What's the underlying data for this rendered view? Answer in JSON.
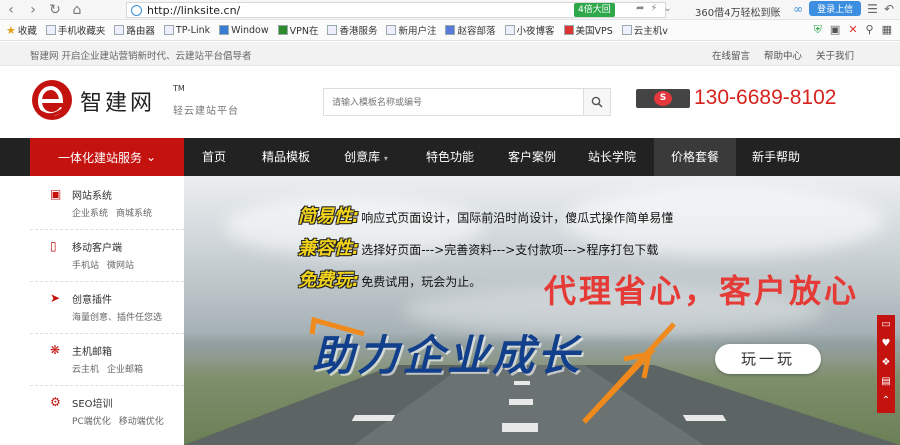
{
  "browser": {
    "url": "http://linksite.cn/",
    "badge": "4倍大回",
    "promo": "360借4万轻松到账",
    "login_button": "登录上信",
    "bookmarks": [
      {
        "label": "收藏",
        "icon": "star-icon"
      },
      {
        "label": "手机收藏夹",
        "icon": "phone-icon"
      },
      {
        "label": "路由器",
        "icon": "router-icon"
      },
      {
        "label": "TP-Link",
        "icon": "page-icon"
      },
      {
        "label": "Window",
        "icon": "windows-icon"
      },
      {
        "label": "VPN在",
        "icon": "vpn-icon"
      },
      {
        "label": "香港服务",
        "icon": "page-icon"
      },
      {
        "label": "新用户注",
        "icon": "page-icon"
      },
      {
        "label": "赵容部落",
        "icon": "user-icon"
      },
      {
        "label": "小夜博客",
        "icon": "page-icon"
      },
      {
        "label": "美国VPS",
        "icon": "vps-icon"
      },
      {
        "label": "云主机v",
        "icon": "page-icon"
      }
    ]
  },
  "site": {
    "tagline": "智建网   开启企业建站营销新时代、云建站平台倡导者",
    "top_links": [
      "在线留言",
      "帮助中心",
      "关于我们"
    ],
    "logo_name": "智建网",
    "logo_tm": "TM",
    "logo_sub": "轻云建站平台",
    "search_placeholder": "请输入模板名称或编号",
    "phone": "130-6689-8102",
    "qq_label": "S"
  },
  "nav": {
    "main_label": "一体化建站服务",
    "items": [
      "首页",
      "精品模板",
      "创意库",
      "特色功能",
      "客户案例",
      "站长学院",
      "价格套餐",
      "新手帮助"
    ]
  },
  "sidebar": [
    {
      "title": "网站系统",
      "subs": [
        "企业系统",
        "商城系统"
      ],
      "icon": "website-icon"
    },
    {
      "title": "移动客户端",
      "subs": [
        "手机站",
        "微网站"
      ],
      "icon": "mobile-icon"
    },
    {
      "title": "创意插件",
      "subs": [
        "海量创意、插件任您选"
      ],
      "icon": "plugin-icon"
    },
    {
      "title": "主机邮箱",
      "subs": [
        "云主机",
        "企业邮箱"
      ],
      "icon": "mail-icon"
    },
    {
      "title": "SEO培训",
      "subs": [
        "PC端优化",
        "移动端优化"
      ],
      "icon": "seo-icon"
    }
  ],
  "banner": {
    "features": [
      {
        "key": "简易性:",
        "desc": "响应式页面设计，国际前沿时尚设计，傻瓜式操作简单易懂"
      },
      {
        "key": "兼容性:",
        "desc": "选择好页面--->完善资料--->支付款项--->程序打包下载"
      },
      {
        "key": "免费玩:",
        "desc": "免费试用，玩会为止。"
      }
    ],
    "slogan_red": "代理省心，客户放心",
    "slogan_blue": "助力企业成长",
    "play_button": "玩一玩"
  },
  "colors": {
    "brand_red": "#c4120f",
    "nav_dark": "#222222",
    "phone_red": "#d7231e",
    "slogan_blue": "#113f8c"
  }
}
